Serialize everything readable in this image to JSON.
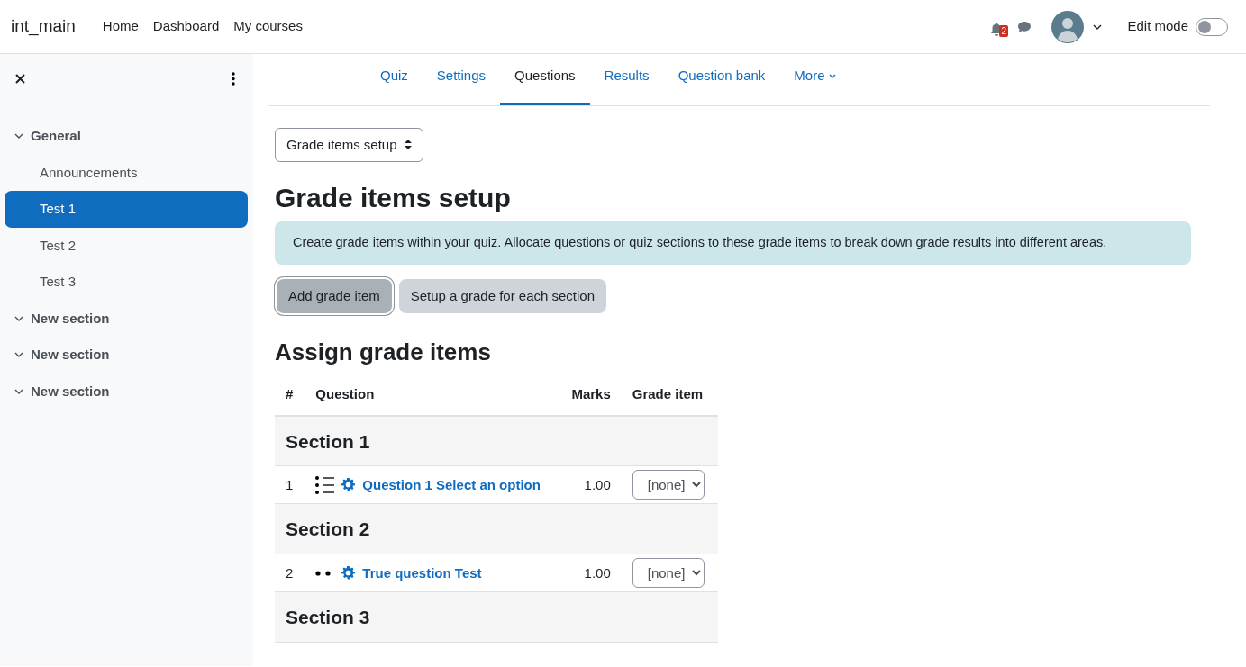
{
  "navbar": {
    "brand": "int_main",
    "links": [
      "Home",
      "Dashboard",
      "My courses"
    ],
    "notification_count": "2",
    "edit_mode": {
      "label": "Edit mode",
      "on": false
    }
  },
  "sidebar": {
    "sections": [
      {
        "title": "General",
        "expanded": true,
        "items": [
          {
            "label": "Announcements",
            "selected": false
          },
          {
            "label": "Test 1",
            "selected": true
          },
          {
            "label": "Test 2",
            "selected": false
          },
          {
            "label": "Test 3",
            "selected": false
          }
        ]
      },
      {
        "title": "New section",
        "expanded": true
      },
      {
        "title": "New section",
        "expanded": true
      },
      {
        "title": "New section",
        "expanded": true
      }
    ]
  },
  "tabs": [
    {
      "label": "Quiz",
      "selected": false
    },
    {
      "label": "Settings",
      "selected": false
    },
    {
      "label": "Questions",
      "selected": true
    },
    {
      "label": "Results",
      "selected": false
    },
    {
      "label": "Question bank",
      "selected": false
    },
    {
      "label": "More",
      "selected": false,
      "kind": "dropdown"
    }
  ],
  "page_selector": "Grade items setup",
  "heading": "Grade items setup",
  "info": "Create grade items within your quiz. Allocate questions or quiz sections to these grade items to break down grade results into different areas.",
  "buttons": [
    {
      "label": "Add grade item",
      "pressed": true
    },
    {
      "label": "Setup a grade for each section",
      "pressed": false
    }
  ],
  "assign": {
    "heading": "Assign grade items",
    "columns": [
      "#",
      "Question",
      "Marks",
      "Grade item"
    ],
    "sections": [
      {
        "title": "Section 1",
        "questions": [
          {
            "number": "1",
            "kind": "multichoice",
            "label": "Question 1 Select an option",
            "marks": "1.00",
            "grade_item": "[none]"
          }
        ]
      },
      {
        "title": "Section 2",
        "questions": [
          {
            "number": "2",
            "kind": "truefalse",
            "label": "True question Test",
            "marks": "1.00",
            "grade_item": "[none]"
          }
        ]
      },
      {
        "title": "Section 3"
      }
    ]
  }
}
